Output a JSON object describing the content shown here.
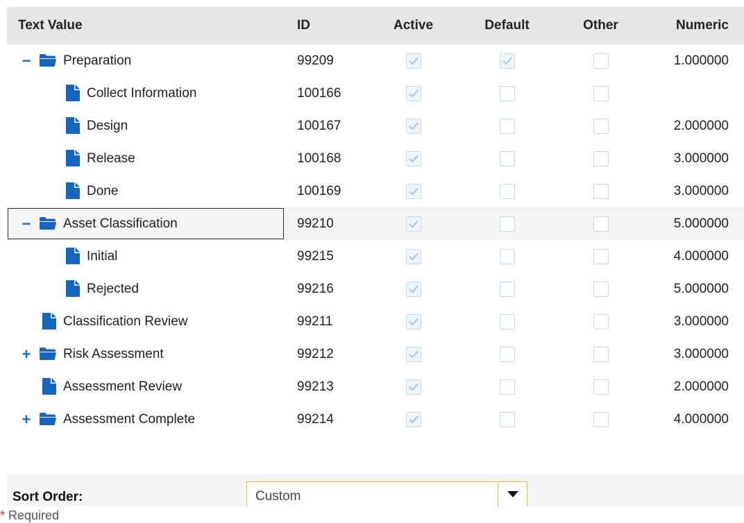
{
  "columns": {
    "text_value": "Text Value",
    "id": "ID",
    "active": "Active",
    "default": "Default",
    "other": "Other",
    "numeric": "Numeric"
  },
  "rows": [
    {
      "label": "Preparation",
      "id": "99209",
      "type": "folder",
      "toggle": "−",
      "level": 0,
      "active": true,
      "default": true,
      "other": false,
      "numeric": "1.000000"
    },
    {
      "label": "Collect Information",
      "id": "100166",
      "type": "file",
      "toggle": "",
      "level": 1,
      "active": true,
      "default": false,
      "other": false,
      "numeric": ""
    },
    {
      "label": "Design",
      "id": "100167",
      "type": "file",
      "toggle": "",
      "level": 1,
      "active": true,
      "default": false,
      "other": false,
      "numeric": "2.000000"
    },
    {
      "label": "Release",
      "id": "100168",
      "type": "file",
      "toggle": "",
      "level": 1,
      "active": true,
      "default": false,
      "other": false,
      "numeric": "3.000000"
    },
    {
      "label": "Done",
      "id": "100169",
      "type": "file",
      "toggle": "",
      "level": 1,
      "active": true,
      "default": false,
      "other": false,
      "numeric": "3.000000"
    },
    {
      "label": "Asset Classification",
      "id": "99210",
      "type": "folder",
      "toggle": "−",
      "level": 0,
      "active": true,
      "default": false,
      "other": false,
      "numeric": "5.000000",
      "selected": true
    },
    {
      "label": "Initial",
      "id": "99215",
      "type": "file",
      "toggle": "",
      "level": 1,
      "active": true,
      "default": false,
      "other": false,
      "numeric": "4.000000"
    },
    {
      "label": "Rejected",
      "id": "99216",
      "type": "file",
      "toggle": "",
      "level": 1,
      "active": true,
      "default": false,
      "other": false,
      "numeric": "5.000000"
    },
    {
      "label": "Classification Review",
      "id": "99211",
      "type": "file",
      "toggle": "",
      "level": 0,
      "active": true,
      "default": false,
      "other": false,
      "numeric": "3.000000"
    },
    {
      "label": "Risk Assessment",
      "id": "99212",
      "type": "folder",
      "toggle": "+",
      "level": 0,
      "active": true,
      "default": false,
      "other": false,
      "numeric": "3.000000"
    },
    {
      "label": "Assessment Review",
      "id": "99213",
      "type": "file",
      "toggle": "",
      "level": 0,
      "active": true,
      "default": false,
      "other": false,
      "numeric": "2.000000"
    },
    {
      "label": "Assessment Complete",
      "id": "99214",
      "type": "folder",
      "toggle": "+",
      "level": 0,
      "active": true,
      "default": false,
      "other": false,
      "numeric": "4.000000"
    }
  ],
  "sort": {
    "label": "Sort Order:",
    "value": "Custom"
  },
  "required": {
    "star": "*",
    "text": " Required"
  },
  "colors": {
    "accent": "#1565c0",
    "select_border": "#f2b632",
    "required_star": "#d0342c"
  },
  "icons": {
    "folder": "folder-open-icon",
    "file": "file-icon",
    "dropdown": "caret-down-icon"
  }
}
